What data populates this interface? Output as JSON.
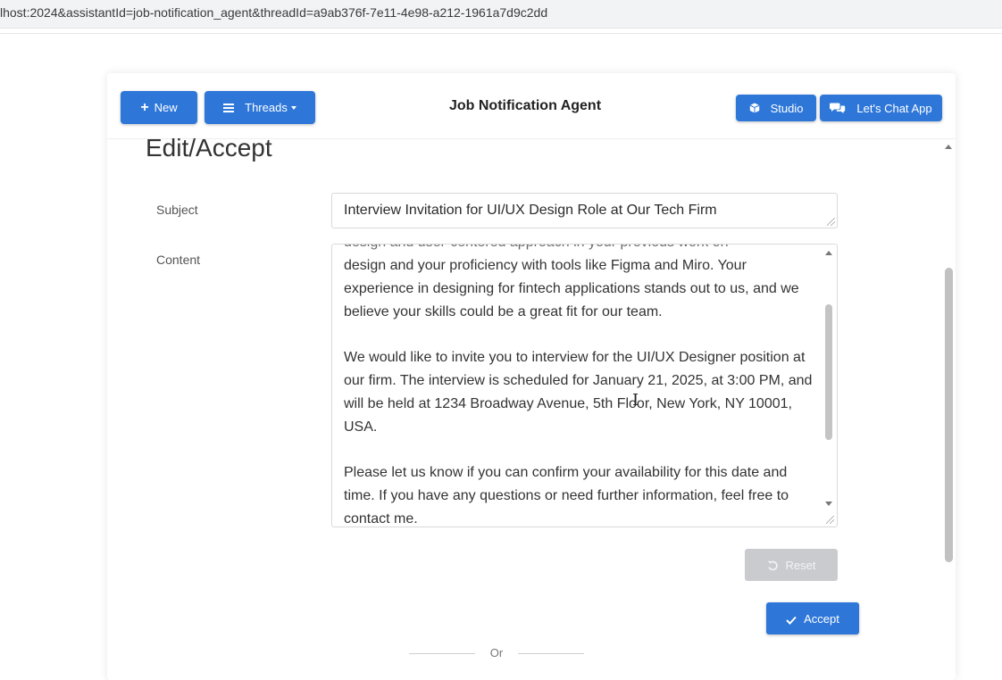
{
  "browser": {
    "url": "lhost:2024&assistantId=job-notification_agent&threadId=a9ab376f-7e11-4e98-a212-1961a7d9c2dd"
  },
  "header": {
    "new_label": "New",
    "threads_label": "Threads",
    "title": "Job Notification Agent",
    "studio_label": "Studio",
    "chat_label": "Let's Chat App"
  },
  "form": {
    "section_title": "Edit/Accept",
    "subject_label": "Subject",
    "subject_value": "Interview Invitation for UI/UX Design Role at Our Tech Firm",
    "content_label": "Content",
    "content_cut_line": "design and user-centered approach in your previous work on",
    "content_paragraphs": [
      "design and your proficiency with tools like Figma and Miro. Your experience in designing for fintech applications stands out to us, and we believe your skills could be a great fit for our team.",
      "We would like to invite you to interview for the UI/UX Designer position at our firm. The interview is scheduled for January 21, 2025, at 3:00 PM, and will be held at 1234 Broadway Avenue, 5th Floor, New York, NY 10001, USA.",
      "Please let us know if you can confirm your availability for this date and time. If you have any questions or need further information, feel free to contact me."
    ]
  },
  "actions": {
    "reset_label": "Reset",
    "accept_label": "Accept",
    "or_label": "Or"
  },
  "colors": {
    "primary": "#2e77d8",
    "disabled": "#c9cbcf"
  }
}
